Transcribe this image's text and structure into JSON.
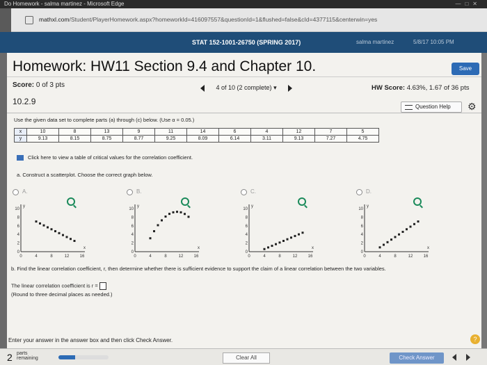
{
  "browser": {
    "title": "Do Homework - salma martinez - Microsoft Edge",
    "url_host": "mathxl.com",
    "url_path": "/Student/PlayerHomework.aspx?homeworkId=416097557&questionId=1&flushed=false&cId=4377115&centerwin=yes"
  },
  "header": {
    "course": "STAT 152-1001-26750 (SPRING 2017)",
    "user": "salma martinez",
    "date": "5/8/17 10:05 PM"
  },
  "homework": {
    "title": "Homework: HW11 Section 9.4 and Chapter 10.",
    "save_label": "Save",
    "score_label": "Score:",
    "score_value": "0 of 3 pts",
    "question_nav": "4 of 10 (2 complete)",
    "hw_score_label": "HW Score:",
    "hw_score_value": "4.63%, 1.67 of 36 pts",
    "question_number": "10.2.9",
    "question_help": "Question Help"
  },
  "question": {
    "instructions": "Use the given data set to complete parts (a) through (c) below. (Use α = 0.05.)",
    "table": {
      "x_label": "x",
      "y_label": "y",
      "x": [
        "10",
        "8",
        "13",
        "9",
        "11",
        "14",
        "6",
        "4",
        "12",
        "7",
        "5"
      ],
      "y": [
        "9.13",
        "8.15",
        "8.75",
        "8.77",
        "9.25",
        "8.09",
        "6.14",
        "3.11",
        "9.13",
        "7.27",
        "4.75"
      ]
    },
    "table_link": "Click here to view a table of critical values for the correlation coefficient.",
    "part_a": "a. Construct a scatterplot. Choose the correct graph below.",
    "options": [
      {
        "label": "A."
      },
      {
        "label": "B."
      },
      {
        "label": "C."
      },
      {
        "label": "D."
      }
    ],
    "graph_y_ticks": [
      "10",
      "8",
      "6",
      "4",
      "2",
      "0"
    ],
    "graph_x_ticks": [
      "0",
      "4",
      "8",
      "12",
      "16"
    ],
    "axis_x": "x",
    "axis_y": "y",
    "part_b": "b. Find the linear correlation coefficient, r, then determine whether there is sufficient evidence to support the claim of a linear correlation between the two variables.",
    "linear_label": "The linear correlation coefficient is r =",
    "round_note": "(Round to three decimal places as needed.)"
  },
  "footer": {
    "enter_text": "Enter your answer in the answer box and then click Check Answer.",
    "parts_count": "2",
    "parts_label_1": "parts",
    "parts_label_2": "remaining",
    "progress_fraction": 0.33,
    "clear_label": "Clear All",
    "check_label": "Check Answer"
  }
}
